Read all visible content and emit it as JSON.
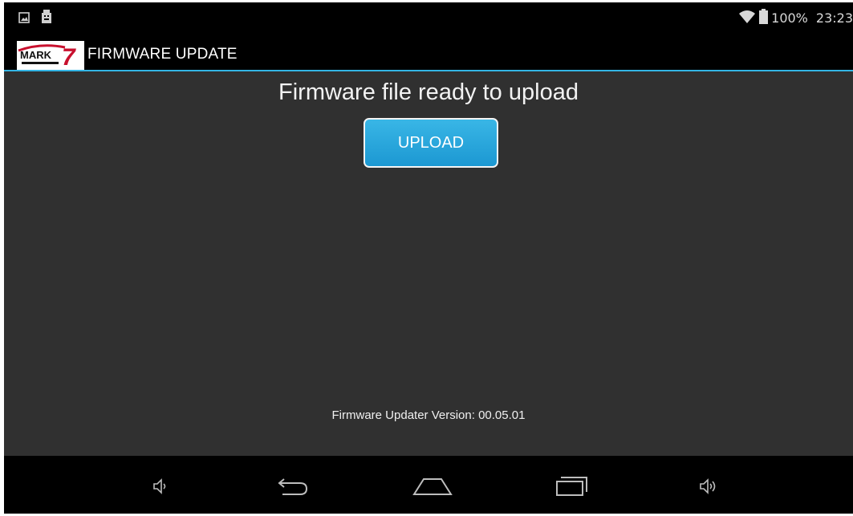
{
  "status_bar": {
    "battery": "100%",
    "time": "23:23",
    "left_icons": [
      "gallery-notification-icon",
      "usb-debugging-icon"
    ],
    "right_icons": [
      "wifi-icon",
      "battery-icon"
    ]
  },
  "action_bar": {
    "logo_text": "MARK7",
    "title": "FIRMWARE UPDATE"
  },
  "main": {
    "headline": "Firmware file ready to upload",
    "upload_button_label": "UPLOAD",
    "version_text": "Firmware Updater Version: 00.05.01"
  },
  "nav_bar": {
    "buttons": [
      "volume-down-icon",
      "back-icon",
      "home-icon",
      "recent-apps-icon",
      "volume-up-icon"
    ]
  },
  "colors": {
    "accent": "#33b5e5",
    "button": "#1c98d2",
    "background": "#303030",
    "bar": "#000000"
  }
}
